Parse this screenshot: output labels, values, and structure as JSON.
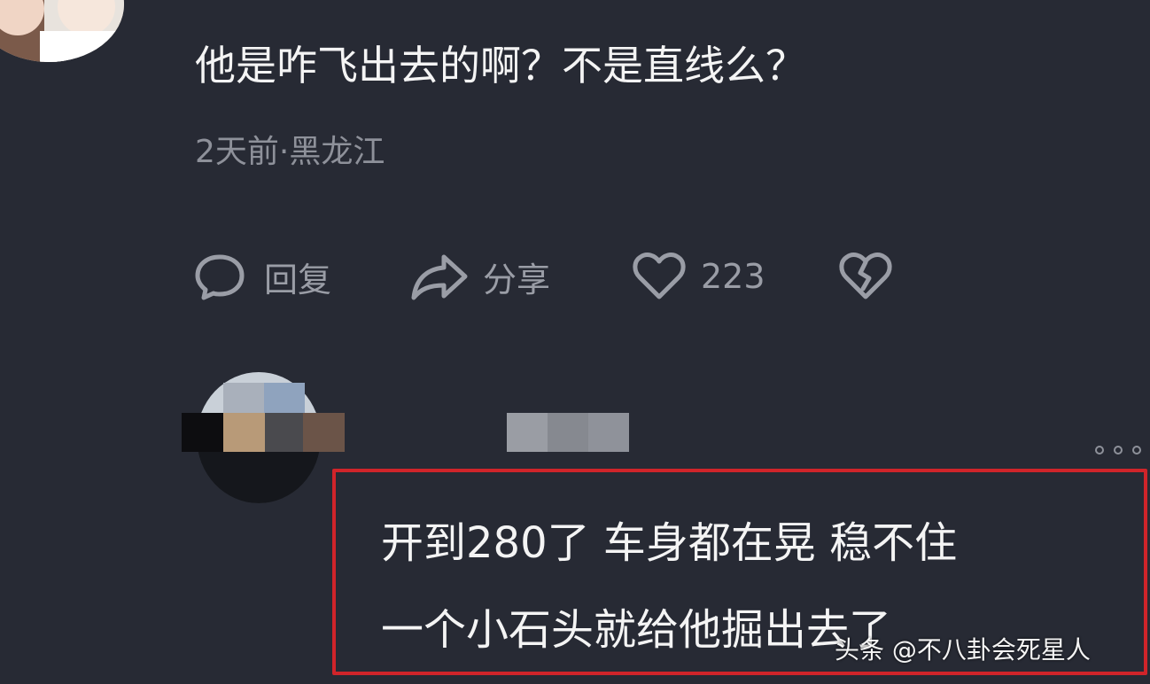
{
  "comment": {
    "text": "他是咋飞出去的啊？不是直线么？",
    "meta": "2天前·黑龙江"
  },
  "actions": {
    "reply_label": "回复",
    "share_label": "分享",
    "like_count": "223",
    "icons": [
      "chat-bubble-icon",
      "share-arrow-icon",
      "heart-icon",
      "broken-heart-icon"
    ]
  },
  "reply": {
    "line1": "开到280了 车身都在晃 稳不住",
    "line2": "一个小石头就给他掘出去了"
  },
  "watermark": "头条 @不八卦会死星人",
  "colors": {
    "background": "#272a34",
    "text": "#f4f4f4",
    "muted": "#8e919a",
    "highlight": "#d0242a"
  }
}
